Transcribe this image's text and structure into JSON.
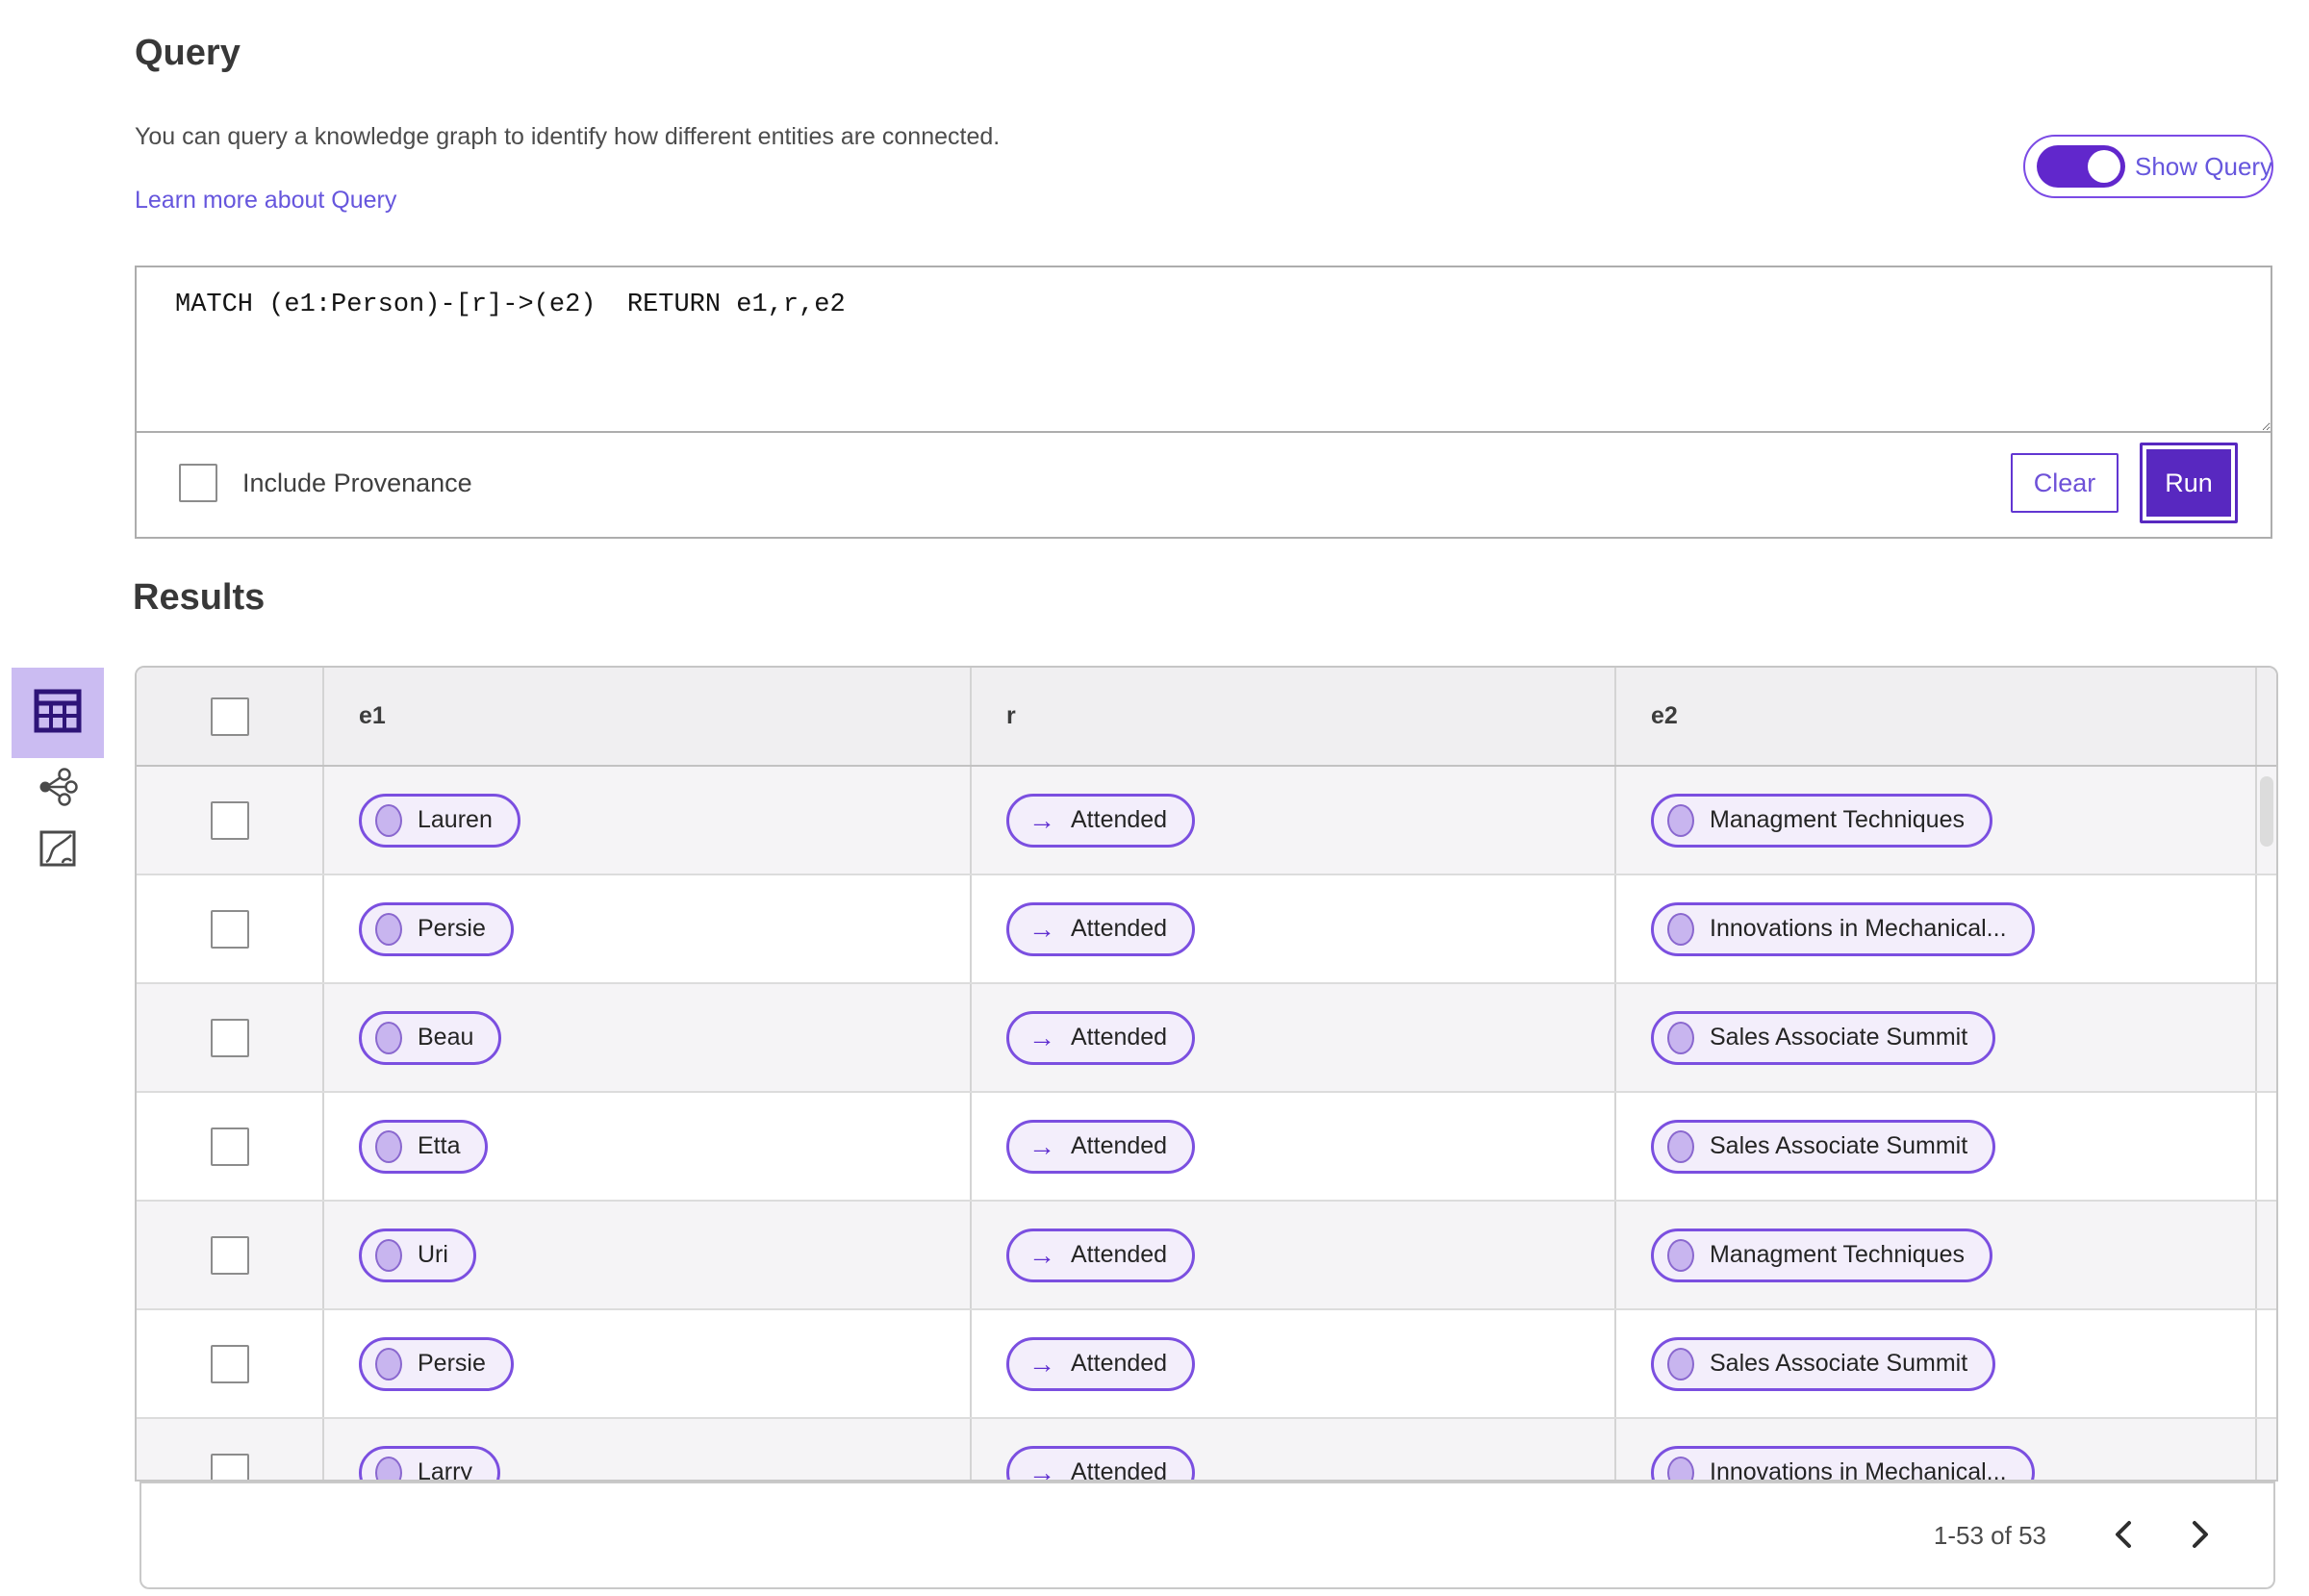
{
  "query_section": {
    "title": "Query",
    "description": "You can query a knowledge graph to identify how different entities are connected.",
    "learn_more_label": "Learn more about Query",
    "show_query_label": "Show Query",
    "show_query_on": true,
    "query_text": "MATCH (e1:Person)-[r]->(e2)  RETURN e1,r,e2",
    "include_provenance_label": "Include Provenance",
    "include_provenance_checked": false,
    "clear_label": "Clear",
    "run_label": "Run"
  },
  "results_section": {
    "title": "Results",
    "view_rail": [
      "table-view-icon",
      "graph-view-icon",
      "chart-view-icon"
    ],
    "selected_view": "table-view-icon",
    "columns": [
      "e1",
      "r",
      "e2"
    ],
    "rows": [
      {
        "e1": "Lauren",
        "r": "Attended",
        "e2": "Managment Techniques"
      },
      {
        "e1": "Persie",
        "r": "Attended",
        "e2": "Innovations in Mechanical..."
      },
      {
        "e1": "Beau",
        "r": "Attended",
        "e2": "Sales Associate Summit"
      },
      {
        "e1": "Etta",
        "r": "Attended",
        "e2": "Sales Associate Summit"
      },
      {
        "e1": "Uri",
        "r": "Attended",
        "e2": "Managment Techniques"
      },
      {
        "e1": "Persie",
        "r": "Attended",
        "e2": "Sales Associate Summit"
      },
      {
        "e1": "Larry",
        "r": "Attended",
        "e2": "Innovations in Mechanical..."
      }
    ],
    "pagination": {
      "range_text": "1-53 of 53"
    }
  },
  "icons": {
    "relation_arrow": "→"
  },
  "colors": {
    "accent_purple": "#5828c0",
    "toggle_purple": "#6127cc",
    "pill_border": "#7b4fe0",
    "pill_background": "#f3eefb",
    "link_purple": "#6656dd",
    "selected_tile_background": "#cbbcf2",
    "header_row_background": "#f0eff1",
    "alt_row_background": "#f5f4f6"
  }
}
